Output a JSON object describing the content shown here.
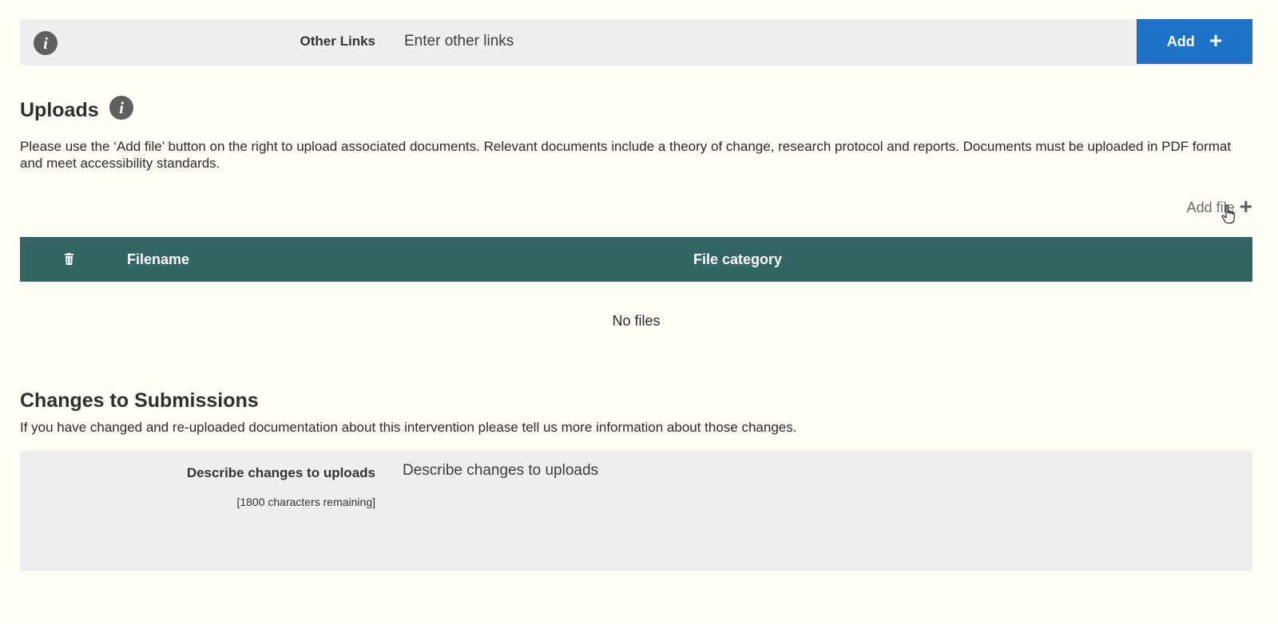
{
  "other_links": {
    "label": "Other Links",
    "placeholder": "Enter other links",
    "add_button_label": "Add",
    "add_button_icon": "+"
  },
  "uploads": {
    "title": "Uploads",
    "description": "Please use the ‘Add file’ button on the right to upload associated documents. Relevant documents include a theory of change, research protocol and reports. Documents must be uploaded in PDF format and meet accessibility standards.",
    "add_file_label": "Add file",
    "add_file_icon": "+",
    "table": {
      "columns": [
        "Filename",
        "File category"
      ],
      "header_color": "#336565",
      "empty_message": "No files"
    }
  },
  "changes": {
    "title": "Changes to Submissions",
    "description": "If you have changed and re-uploaded documentation about this intervention please tell us more information about those changes.",
    "field_label": "Describe changes to uploads",
    "remaining": "[1800 characters remaining]",
    "placeholder": "Describe changes to uploads"
  },
  "colors": {
    "accent": "#1e72c7",
    "background": "#fffdf6",
    "field_background": "#efefef"
  },
  "icons": {
    "info": "info-icon",
    "delete": "trash-icon",
    "add": "plus-icon",
    "cursor": "hand-pointer-icon"
  }
}
